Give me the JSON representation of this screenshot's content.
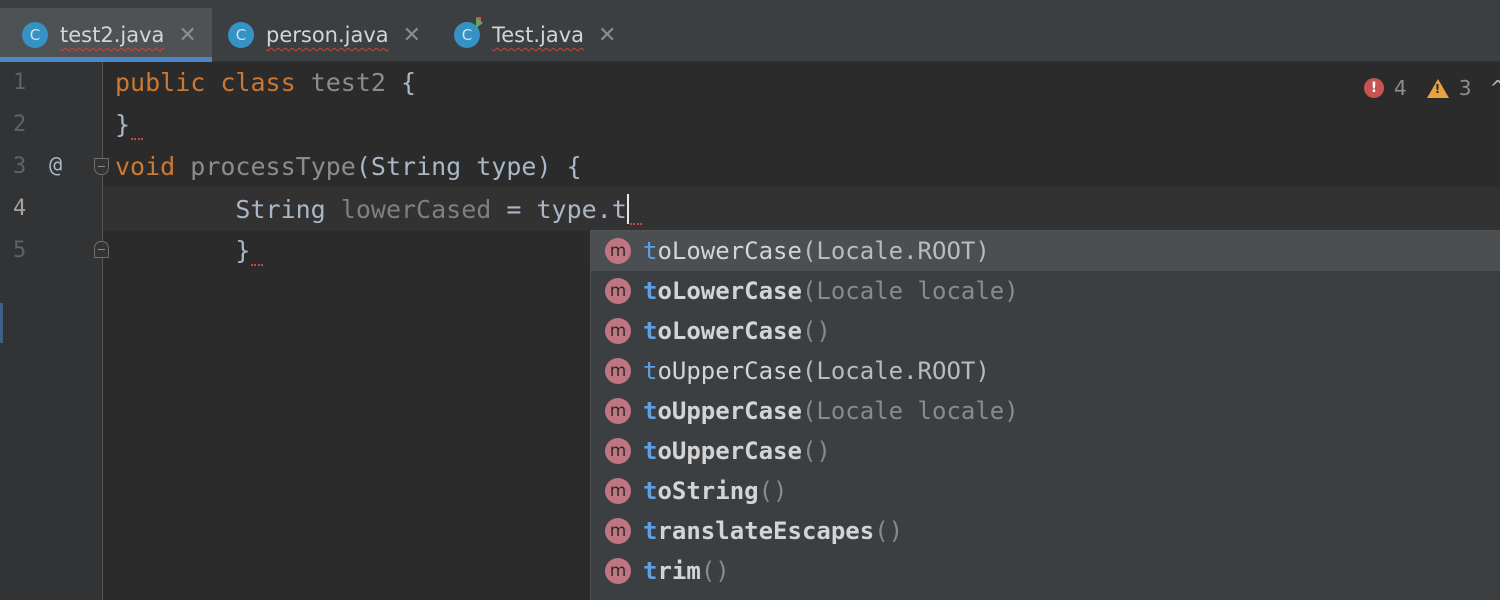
{
  "tabs": [
    {
      "label": "test2.java",
      "icon": "class-icon",
      "icon_letter": "C",
      "active": true
    },
    {
      "label": "person.java",
      "icon": "class-icon",
      "icon_letter": "C",
      "active": false
    },
    {
      "label": "Test.java",
      "icon": "runnable-class-icon",
      "icon_letter": "C",
      "active": false
    }
  ],
  "tab_close_glyph": "✕",
  "gutter": {
    "line_numbers": [
      "1",
      "2",
      "3",
      "4",
      "5"
    ],
    "annotation_glyph": "@"
  },
  "code": {
    "line1": {
      "kw1": "public",
      "kw2": "class",
      "name": "test2",
      "rest": "{"
    },
    "line2": {
      "text": "}"
    },
    "line3": {
      "kw": "void",
      "name": "processType",
      "rest": "(String type) {"
    },
    "line4": {
      "indent": "        ",
      "type": "String",
      "var": "lowerCased",
      "rest": "= type.t"
    },
    "line5": {
      "indent": "        ",
      "text": "}"
    }
  },
  "inspections": {
    "errors": "4",
    "warnings": "3",
    "error_glyph": "!",
    "warning_glyph": "!",
    "chevron": "^"
  },
  "completion": {
    "icon_letter": "m",
    "items": [
      {
        "match": "t",
        "rest": "oLowerCase",
        "params": "(Locale.ROOT)",
        "style": "plain",
        "selected": true
      },
      {
        "match": "t",
        "rest": "oLowerCase",
        "params": "(Locale locale)",
        "style": "bold"
      },
      {
        "match": "t",
        "rest": "oLowerCase",
        "params": "()",
        "style": "bold"
      },
      {
        "match": "t",
        "rest": "oUpperCase",
        "params": "(Locale.ROOT)",
        "style": "plain"
      },
      {
        "match": "t",
        "rest": "oUpperCase",
        "params": "(Locale locale)",
        "style": "bold"
      },
      {
        "match": "t",
        "rest": "oUpperCase",
        "params": "()",
        "style": "bold"
      },
      {
        "match": "t",
        "rest": "oString",
        "params": "()",
        "style": "bold"
      },
      {
        "match": "t",
        "rest": "ranslateEscapes",
        "params": "()",
        "style": "bold"
      },
      {
        "match": "t",
        "rest": "rim",
        "params": "()",
        "style": "bold"
      }
    ]
  },
  "colors": {
    "editor_bg": "#2b2b2b",
    "keyword": "#cc7832",
    "selected_tab_underline": "#4a88c7",
    "class_icon": "#3592c4",
    "method_icon": "#c17582",
    "match_highlight": "#5f9fe5",
    "error": "#c75450",
    "warning": "#e8a33e"
  }
}
